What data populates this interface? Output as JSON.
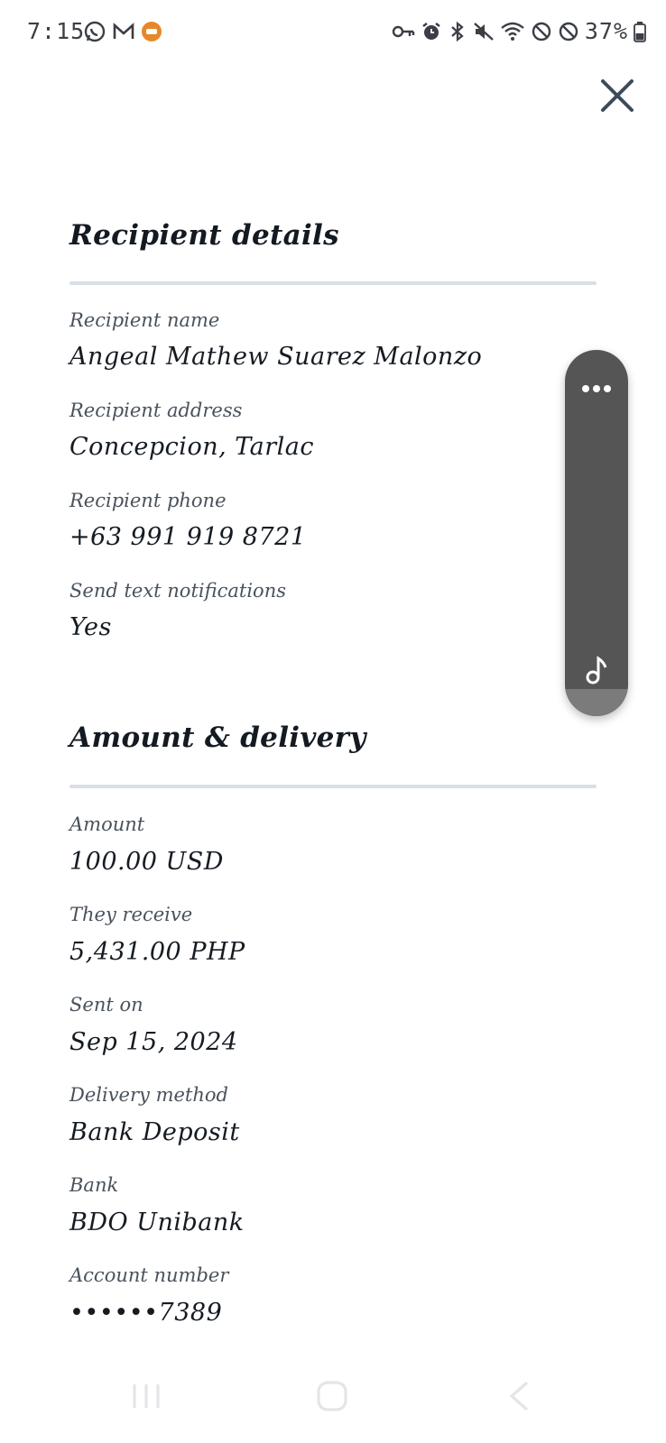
{
  "status_bar": {
    "time": "7:15",
    "battery": "37%",
    "left_icons": [
      "whatsapp-icon",
      "gmail-icon",
      "notification-badge-icon"
    ],
    "right_icons": [
      "key-icon",
      "alarm-icon",
      "bluetooth-icon",
      "mute-icon",
      "wifi-icon",
      "blocked-icon",
      "blocked-icon",
      "battery-icon"
    ]
  },
  "recipient_details": {
    "title": "Recipient details",
    "fields": [
      {
        "label": "Recipient name",
        "value": "Angeal Mathew Suarez Malonzo"
      },
      {
        "label": "Recipient address",
        "value": "Concepcion, Tarlac"
      },
      {
        "label": "Recipient phone",
        "value": "+63 991 919 8721"
      },
      {
        "label": "Send text notifications",
        "value": "Yes"
      }
    ]
  },
  "amount_delivery": {
    "title": "Amount & delivery",
    "fields": [
      {
        "label": "Amount",
        "value": "100.00 USD"
      },
      {
        "label": "They receive",
        "value": "5,431.00 PHP"
      },
      {
        "label": "Sent on",
        "value": "Sep 15, 2024"
      },
      {
        "label": "Delivery method",
        "value": "Bank Deposit"
      },
      {
        "label": "Bank",
        "value": "BDO Unibank"
      },
      {
        "label": "Account number",
        "value": "••••••7389"
      }
    ]
  },
  "colors": {
    "panel": "#555555",
    "divider": "#d9dfe7",
    "close_icon": "#3d4a5a"
  }
}
